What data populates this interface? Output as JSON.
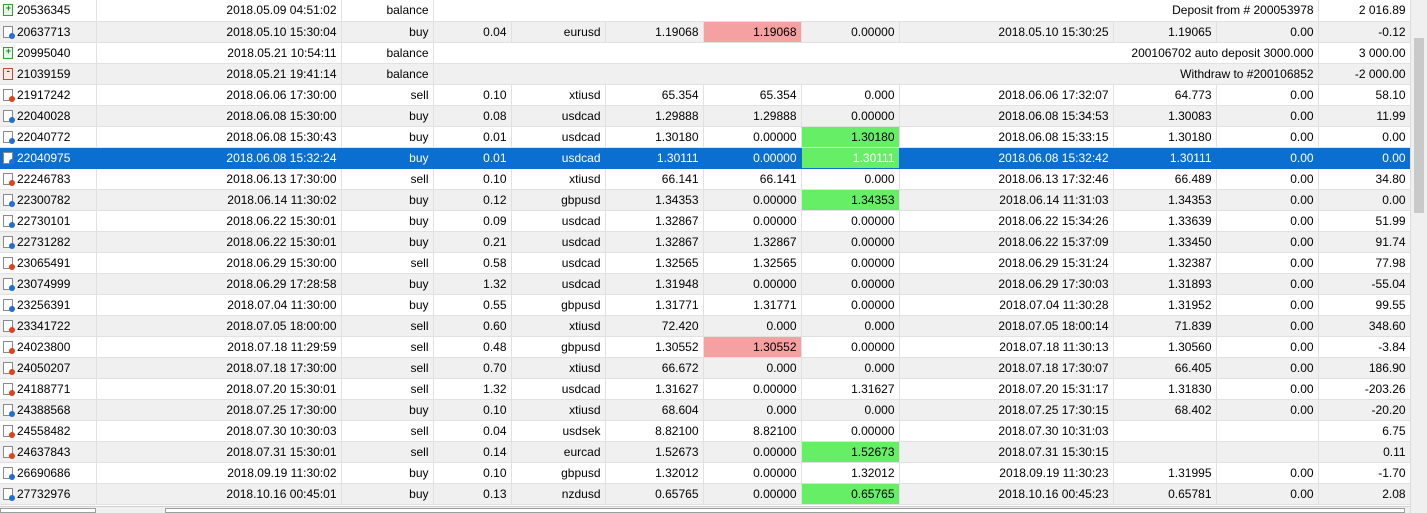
{
  "rows": [
    {
      "ticket": "20536345",
      "type": "balance",
      "icon": "deposit-icon",
      "open_time": "2018.05.09 04:51:02",
      "comment": "Deposit from # 200053978",
      "profit": "2 016.89"
    },
    {
      "ticket": "20637713",
      "type": "buy",
      "icon": "buy-icon",
      "open_time": "2018.05.10 15:30:04",
      "size": "0.04",
      "symbol": "eurusd",
      "price": "1.19068",
      "sl": "1.19068",
      "sl_hl": "red",
      "tp": "0.00000",
      "close_time": "2018.05.10 15:30:25",
      "close_price": "1.19065",
      "swap": "0.00",
      "profit": "-0.12"
    },
    {
      "ticket": "20995040",
      "type": "balance",
      "icon": "deposit-icon",
      "open_time": "2018.05.21 10:54:11",
      "comment": "200106702 auto deposit 3000.000",
      "profit": "3 000.00"
    },
    {
      "ticket": "21039159",
      "type": "balance",
      "icon": "withdraw-icon",
      "open_time": "2018.05.21 19:41:14",
      "comment": "Withdraw to #200106852",
      "profit": "-2 000.00"
    },
    {
      "ticket": "21917242",
      "type": "sell",
      "icon": "sell-icon",
      "open_time": "2018.06.06 17:30:00",
      "size": "0.10",
      "symbol": "xtiusd",
      "price": "65.354",
      "sl": "65.354",
      "tp": "0.000",
      "close_time": "2018.06.06 17:32:07",
      "close_price": "64.773",
      "swap": "0.00",
      "profit": "58.10"
    },
    {
      "ticket": "22040028",
      "type": "buy",
      "icon": "buy-icon",
      "open_time": "2018.06.08 15:30:00",
      "size": "0.08",
      "symbol": "usdcad",
      "price": "1.29888",
      "sl": "1.29888",
      "tp": "0.00000",
      "close_time": "2018.06.08 15:34:53",
      "close_price": "1.30083",
      "swap": "0.00",
      "profit": "11.99"
    },
    {
      "ticket": "22040772",
      "type": "buy",
      "icon": "buy-icon",
      "open_time": "2018.06.08 15:30:43",
      "size": "0.01",
      "symbol": "usdcad",
      "price": "1.30180",
      "sl": "0.00000",
      "tp": "1.30180",
      "tp_hl": "green",
      "close_time": "2018.06.08 15:33:15",
      "close_price": "1.30180",
      "swap": "0.00",
      "profit": "0.00"
    },
    {
      "ticket": "22040975",
      "type": "buy",
      "icon": "buy-icon",
      "selected": true,
      "open_time": "2018.06.08 15:32:24",
      "size": "0.01",
      "symbol": "usdcad",
      "price": "1.30111",
      "sl": "0.00000",
      "tp": "1.30111",
      "tp_hl": "green",
      "close_time": "2018.06.08 15:32:42",
      "close_price": "1.30111",
      "swap": "0.00",
      "profit": "0.00"
    },
    {
      "ticket": "22246783",
      "type": "sell",
      "icon": "sell-icon",
      "open_time": "2018.06.13 17:30:00",
      "size": "0.10",
      "symbol": "xtiusd",
      "price": "66.141",
      "sl": "66.141",
      "tp": "0.000",
      "close_time": "2018.06.13 17:32:46",
      "close_price": "66.489",
      "swap": "0.00",
      "profit": "34.80"
    },
    {
      "ticket": "22300782",
      "type": "buy",
      "icon": "buy-icon",
      "open_time": "2018.06.14 11:30:02",
      "size": "0.12",
      "symbol": "gbpusd",
      "price": "1.34353",
      "sl": "0.00000",
      "tp": "1.34353",
      "tp_hl": "green",
      "close_time": "2018.06.14 11:31:03",
      "close_price": "1.34353",
      "swap": "0.00",
      "profit": "0.00"
    },
    {
      "ticket": "22730101",
      "type": "buy",
      "icon": "buy-icon",
      "open_time": "2018.06.22 15:30:01",
      "size": "0.09",
      "symbol": "usdcad",
      "price": "1.32867",
      "sl": "0.00000",
      "tp": "0.00000",
      "close_time": "2018.06.22 15:34:26",
      "close_price": "1.33639",
      "swap": "0.00",
      "profit": "51.99"
    },
    {
      "ticket": "22731282",
      "type": "buy",
      "icon": "buy-icon",
      "open_time": "2018.06.22 15:30:01",
      "size": "0.21",
      "symbol": "usdcad",
      "price": "1.32867",
      "sl": "1.32867",
      "tp": "0.00000",
      "close_time": "2018.06.22 15:37:09",
      "close_price": "1.33450",
      "swap": "0.00",
      "profit": "91.74"
    },
    {
      "ticket": "23065491",
      "type": "sell",
      "icon": "sell-icon",
      "open_time": "2018.06.29 15:30:00",
      "size": "0.58",
      "symbol": "usdcad",
      "price": "1.32565",
      "sl": "1.32565",
      "tp": "0.00000",
      "close_time": "2018.06.29 15:31:24",
      "close_price": "1.32387",
      "swap": "0.00",
      "profit": "77.98"
    },
    {
      "ticket": "23074999",
      "type": "buy",
      "icon": "buy-icon",
      "open_time": "2018.06.29 17:28:58",
      "size": "1.32",
      "symbol": "usdcad",
      "price": "1.31948",
      "sl": "0.00000",
      "tp": "0.00000",
      "close_time": "2018.06.29 17:30:03",
      "close_price": "1.31893",
      "swap": "0.00",
      "profit": "-55.04"
    },
    {
      "ticket": "23256391",
      "type": "buy",
      "icon": "buy-icon",
      "open_time": "2018.07.04 11:30:00",
      "size": "0.55",
      "symbol": "gbpusd",
      "price": "1.31771",
      "sl": "1.31771",
      "tp": "0.00000",
      "close_time": "2018.07.04 11:30:28",
      "close_price": "1.31952",
      "swap": "0.00",
      "profit": "99.55"
    },
    {
      "ticket": "23341722",
      "type": "sell",
      "icon": "sell-icon",
      "open_time": "2018.07.05 18:00:00",
      "size": "0.60",
      "symbol": "xtiusd",
      "price": "72.420",
      "sl": "0.000",
      "tp": "0.000",
      "close_time": "2018.07.05 18:00:14",
      "close_price": "71.839",
      "swap": "0.00",
      "profit": "348.60"
    },
    {
      "ticket": "24023800",
      "type": "sell",
      "icon": "sell-icon",
      "open_time": "2018.07.18 11:29:59",
      "size": "0.48",
      "symbol": "gbpusd",
      "price": "1.30552",
      "sl": "1.30552",
      "sl_hl": "red",
      "tp": "0.00000",
      "close_time": "2018.07.18 11:30:13",
      "close_price": "1.30560",
      "swap": "0.00",
      "profit": "-3.84"
    },
    {
      "ticket": "24050207",
      "type": "sell",
      "icon": "sell-icon",
      "open_time": "2018.07.18 17:30:00",
      "size": "0.70",
      "symbol": "xtiusd",
      "price": "66.672",
      "sl": "0.000",
      "tp": "0.000",
      "close_time": "2018.07.18 17:30:07",
      "close_price": "66.405",
      "swap": "0.00",
      "profit": "186.90"
    },
    {
      "ticket": "24188771",
      "type": "sell",
      "icon": "sell-icon",
      "open_time": "2018.07.20 15:30:01",
      "size": "1.32",
      "symbol": "usdcad",
      "price": "1.31627",
      "sl": "0.00000",
      "tp": "1.31627",
      "close_time": "2018.07.20 15:31:17",
      "close_price": "1.31830",
      "swap": "0.00",
      "profit": "-203.26"
    },
    {
      "ticket": "24388568",
      "type": "buy",
      "icon": "buy-icon",
      "open_time": "2018.07.25 17:30:00",
      "size": "0.10",
      "symbol": "xtiusd",
      "price": "68.604",
      "sl": "0.000",
      "tp": "0.000",
      "close_time": "2018.07.25 17:30:15",
      "close_price": "68.402",
      "swap": "0.00",
      "profit": "-20.20"
    },
    {
      "ticket": "24558482",
      "type": "sell",
      "icon": "sell-icon",
      "open_time": "2018.07.30 10:30:03",
      "size": "0.04",
      "symbol": "usdsek",
      "price": "8.82100",
      "sl": "8.82100",
      "tp": "0.00000",
      "close_time": "2018.07.30 10:31:03",
      "close_price": "",
      "swap": "",
      "profit": "6.75"
    },
    {
      "ticket": "24637843",
      "type": "sell",
      "icon": "sell-icon",
      "open_time": "2018.07.31 15:30:01",
      "size": "0.14",
      "symbol": "eurcad",
      "price": "1.52673",
      "sl": "0.00000",
      "tp": "1.52673",
      "tp_hl": "green",
      "close_time": "2018.07.31 15:30:15",
      "close_price": "",
      "swap": "",
      "profit": "0.11"
    },
    {
      "ticket": "26690686",
      "type": "buy",
      "icon": "buy-icon",
      "open_time": "2018.09.19 11:30:02",
      "size": "0.10",
      "symbol": "gbpusd",
      "price": "1.32012",
      "sl": "0.00000",
      "tp": "1.32012",
      "close_time": "2018.09.19 11:30:23",
      "close_price": "1.31995",
      "swap": "0.00",
      "profit": "-1.70"
    },
    {
      "ticket": "27732976",
      "type": "buy",
      "icon": "buy-icon",
      "open_time": "2018.10.16 00:45:01",
      "size": "0.13",
      "symbol": "nzdusd",
      "price": "0.65765",
      "sl": "0.00000",
      "tp": "0.65765",
      "tp_hl": "green",
      "close_time": "2018.10.16 00:45:23",
      "close_price": "0.65781",
      "swap": "0.00",
      "profit": "2.08"
    }
  ]
}
